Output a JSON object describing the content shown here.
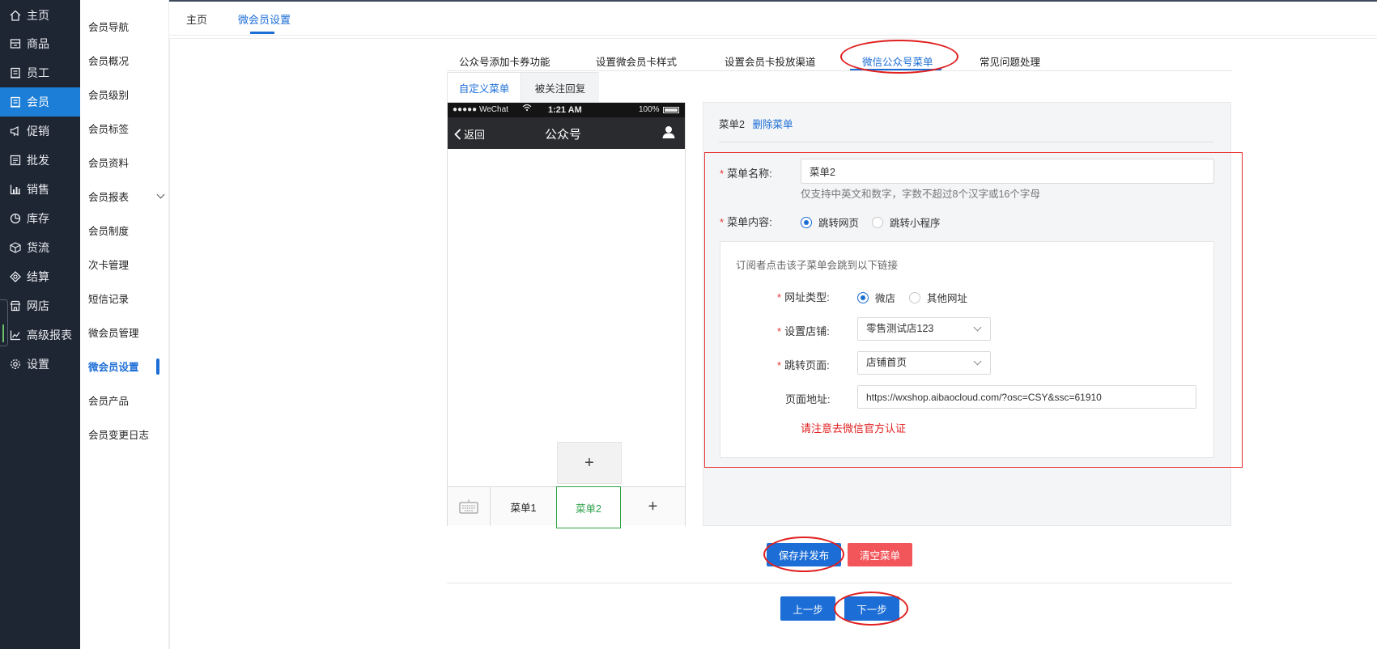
{
  "nav": {
    "items": [
      {
        "label": "主页",
        "icon": "home-icon"
      },
      {
        "label": "商品",
        "icon": "goods-icon"
      },
      {
        "label": "员工",
        "icon": "staff-icon"
      },
      {
        "label": "会员",
        "icon": "member-icon"
      },
      {
        "label": "促销",
        "icon": "megaphone-icon"
      },
      {
        "label": "批发",
        "icon": "wholesale-icon"
      },
      {
        "label": "销售",
        "icon": "bar-chart-icon"
      },
      {
        "label": "库存",
        "icon": "pie-chart-icon"
      },
      {
        "label": "货流",
        "icon": "cube-icon"
      },
      {
        "label": "结算",
        "icon": "settle-icon"
      },
      {
        "label": "网店",
        "icon": "shop-icon"
      },
      {
        "label": "高级报表",
        "icon": "line-chart-icon"
      },
      {
        "label": "设置",
        "icon": "gear-icon"
      }
    ],
    "active": "会员"
  },
  "subnav": {
    "items": [
      "会员导航",
      "会员概况",
      "会员级别",
      "会员标签",
      "会员资料",
      "会员报表",
      "会员制度",
      "次卡管理",
      "短信记录",
      "微会员管理",
      "微会员设置",
      "会员产品",
      "会员变更日志"
    ],
    "active": "微会员设置"
  },
  "topbar": {
    "tabs": [
      "主页",
      "微会员设置"
    ],
    "active": "微会员设置"
  },
  "main_tabs": {
    "items": [
      "公众号添加卡券功能",
      "设置微会员卡样式",
      "设置会员卡投放渠道",
      "微信公众号菜单",
      "常见问题处理"
    ],
    "active": "微信公众号菜单"
  },
  "sub_tabs": {
    "items": [
      "自定义菜单",
      "被关注回复"
    ],
    "active": "自定义菜单"
  },
  "phone": {
    "carrier": "●●●●● WeChat",
    "time": "1:21 AM",
    "battery": "100%",
    "back_label": "返回",
    "title": "公众号",
    "add_sub_symbol": "+",
    "menus": [
      "菜单1",
      "菜单2"
    ],
    "add_menu_symbol": "+",
    "selected_menu": "菜单2"
  },
  "editor": {
    "menu_name_header": "菜单2",
    "delete_link": "删除菜单",
    "name_label": "菜单名称:",
    "name_value": "菜单2",
    "name_hint": "仅支持中英文和数字，字数不超过8个汉字或16个字母",
    "content_label": "菜单内容:",
    "content_options": [
      "跳转网页",
      "跳转小程序"
    ],
    "content_selected": "跳转网页",
    "inner_desc": "订阅者点击该子菜单会跳到以下链接",
    "url_type_label": "网址类型:",
    "url_type_options": [
      "微店",
      "其他网址"
    ],
    "url_type_selected": "微店",
    "shop_label": "设置店铺:",
    "shop_value": "零售测试店123",
    "page_label": "跳转页面:",
    "page_value": "店铺首页",
    "address_label": "页面地址:",
    "address_value": "https://wxshop.aibaocloud.com/?osc=CSY&ssc=61910",
    "warning": "请注意去微信官方认证"
  },
  "actions": {
    "save": "保存并发布",
    "clear": "清空菜单",
    "prev": "上一步",
    "next": "下一步"
  },
  "colors": {
    "nav_bg": "#1f2633",
    "accent": "#1c6ed6",
    "danger": "#f2555a",
    "selected_green": "#2fa24a",
    "annotation_red": "#e01f1f"
  }
}
